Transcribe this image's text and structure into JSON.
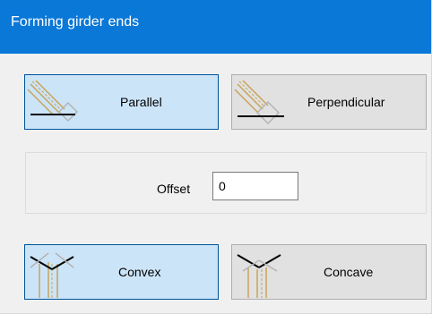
{
  "window": {
    "title": "Forming girder ends"
  },
  "orientation": {
    "selected": "Parallel",
    "options": [
      {
        "label": "Parallel",
        "icon": "parallel-girder-icon"
      },
      {
        "label": "Perpendicular",
        "icon": "perpendicular-girder-icon"
      }
    ]
  },
  "offset": {
    "label": "Offset",
    "value": "0"
  },
  "shape": {
    "selected": "Convex",
    "options": [
      {
        "label": "Convex",
        "icon": "convex-girder-icon"
      },
      {
        "label": "Concave",
        "icon": "concave-girder-icon"
      }
    ]
  },
  "colors": {
    "accent": "#0a78d7",
    "selected_bg": "#cce4f7",
    "selected_border": "#005499",
    "wood": "#c8a45a"
  }
}
